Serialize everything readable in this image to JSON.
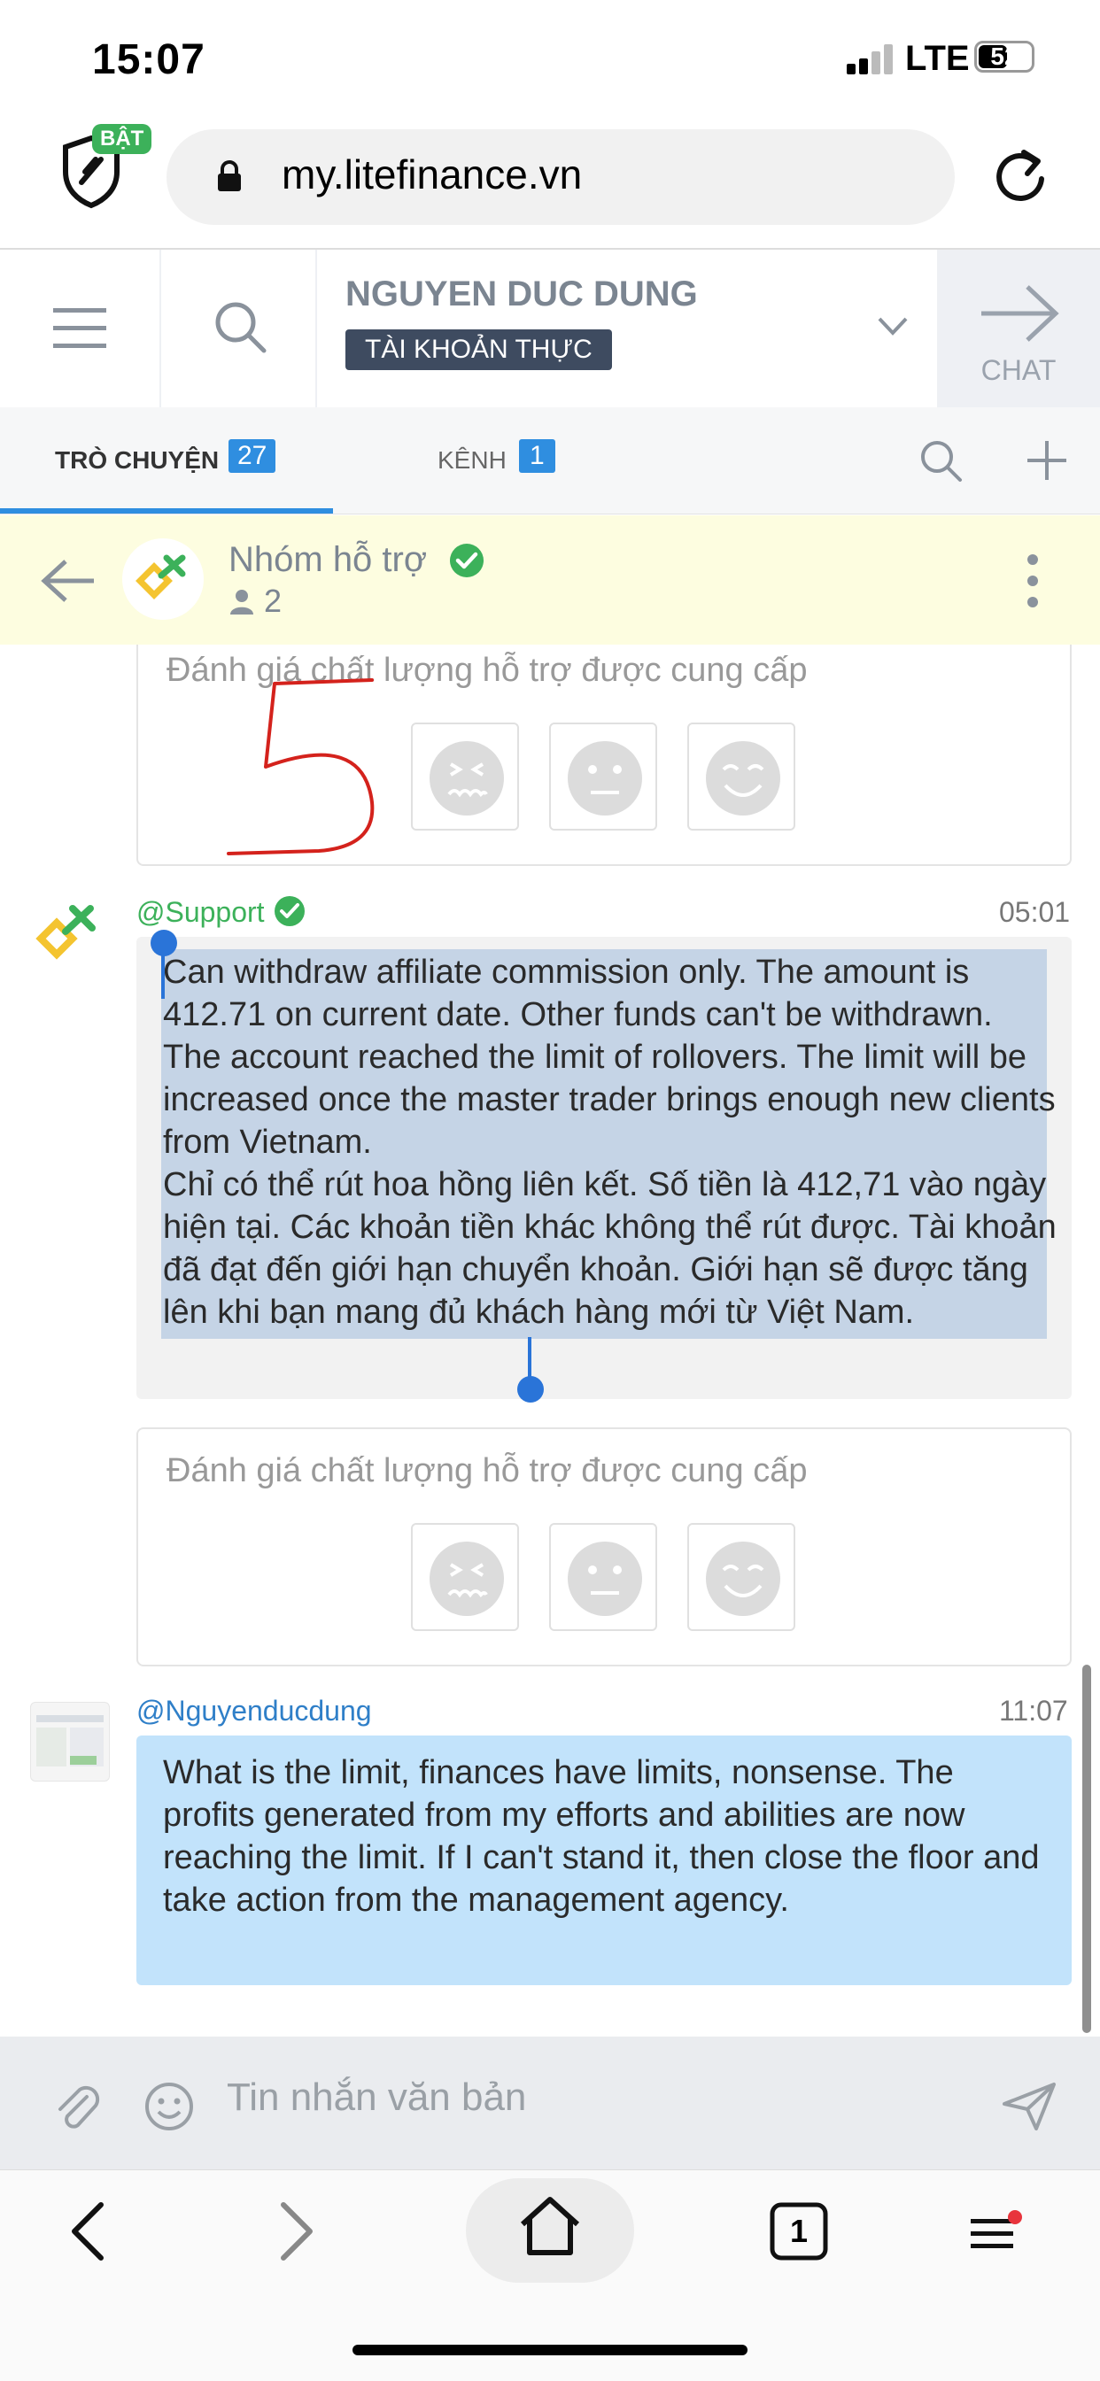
{
  "status_bar": {
    "time": "15:07",
    "network": "LTE",
    "battery": "52"
  },
  "browser": {
    "shield_badge": "BẬT",
    "url": "my.litefinance.vn",
    "tab_count": "1"
  },
  "header": {
    "account_name": "NGUYEN DUC DUNG",
    "account_type": "TÀI KHOẢN THỰC",
    "chat_label": "CHAT"
  },
  "tabs": [
    {
      "label": "TRÒ CHUYỆN",
      "count": "27",
      "active": true
    },
    {
      "label": "KÊNH",
      "count": "1",
      "active": false
    }
  ],
  "group": {
    "name": "Nhóm hỗ trợ",
    "members": "2"
  },
  "colors": {
    "accent_blue": "#2f8ee0",
    "verified_green": "#3cb15a",
    "selection": "#c5d4e6",
    "own_bubble": "#c2e3fb",
    "group_header_bg": "#fdfde0"
  },
  "rating": {
    "title": "Đánh giá chất lượng hỗ trợ được cung cấp",
    "options": [
      "sad-face-icon",
      "neutral-face-icon",
      "happy-face-icon"
    ]
  },
  "messages": [
    {
      "author": "@Support",
      "time": "05:01",
      "text": "Can withdraw affiliate commission only. The amount is 412.71 on current date. Other funds can't be withdrawn. The account reached the limit of rollovers. The limit will be increased once the master trader brings enough new clients from Vietnam.\nChỉ có thể rút hoa hồng liên kết. Số tiền là 412,71 vào ngày hiện tại. Các khoản tiền khác không thể rút được. Tài khoản đã đạt đến giới hạn chuyển khoản. Giới hạn sẽ được tăng lên khi bạn mang đủ khách hàng mới từ Việt Nam."
    },
    {
      "author": "@Nguyenducdung",
      "time": "11:07",
      "text": "What is the limit, finances have limits, nonsense. The profits generated from my efforts and abilities are now reaching the limit. If I can't stand it, then close the floor and take action from the management agency."
    }
  ],
  "annotation": "5",
  "composer": {
    "placeholder": "Tin nhắn văn bản"
  }
}
